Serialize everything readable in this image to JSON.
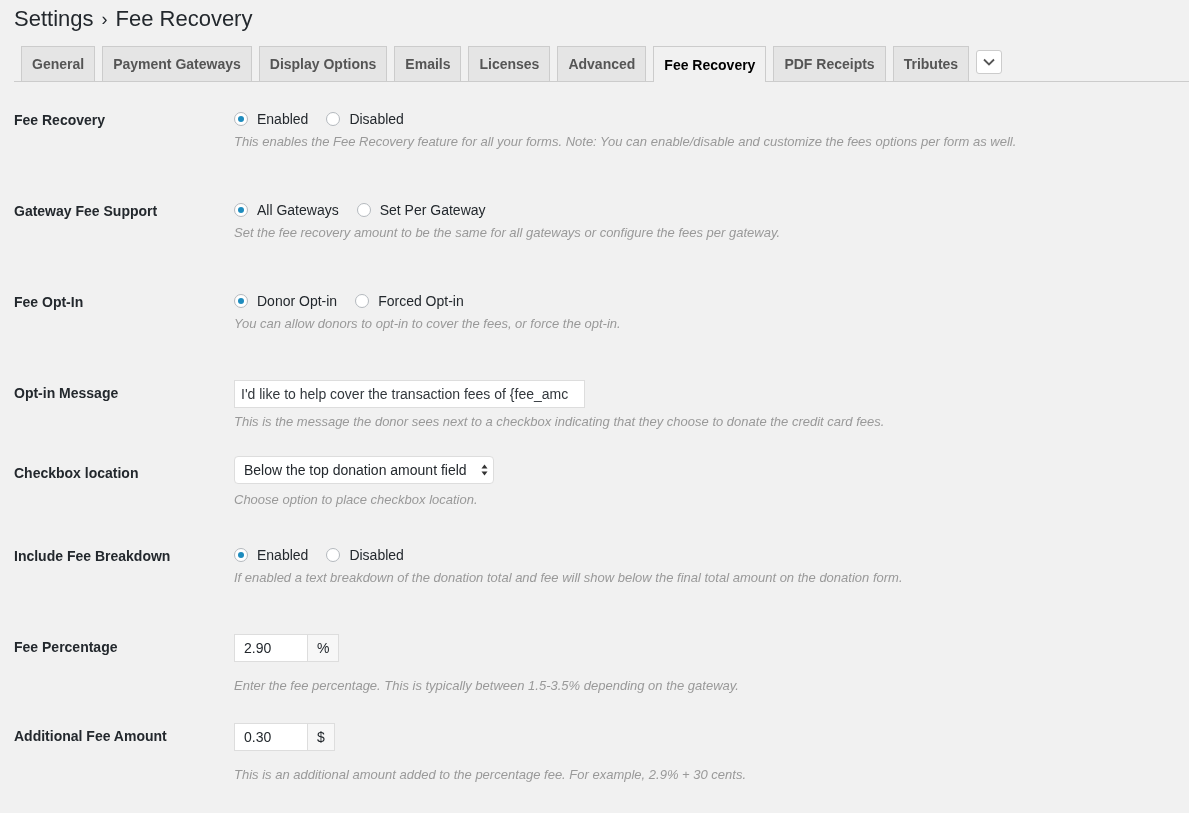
{
  "title": {
    "section": "Settings",
    "separator": "›",
    "page": "Fee Recovery"
  },
  "tabs": [
    {
      "label": "General",
      "selected": false
    },
    {
      "label": "Payment Gateways",
      "selected": false
    },
    {
      "label": "Display Options",
      "selected": false
    },
    {
      "label": "Emails",
      "selected": false
    },
    {
      "label": "Licenses",
      "selected": false
    },
    {
      "label": "Advanced",
      "selected": false
    },
    {
      "label": "Fee Recovery",
      "selected": true
    },
    {
      "label": "PDF Receipts",
      "selected": false
    },
    {
      "label": "Tributes",
      "selected": false
    }
  ],
  "settings": [
    {
      "kind": "radio",
      "label": "Fee Recovery",
      "options": [
        {
          "label": "Enabled",
          "selected": true
        },
        {
          "label": "Disabled",
          "selected": false
        }
      ],
      "description": "This enables the Fee Recovery feature for all your forms. Note: You can enable/disable and customize the fees options per form as well."
    },
    {
      "kind": "radio",
      "label": "Gateway Fee Support",
      "options": [
        {
          "label": "All Gateways",
          "selected": true
        },
        {
          "label": "Set Per Gateway",
          "selected": false
        }
      ],
      "description": "Set the fee recovery amount to be the same for all gateways or configure the fees per gateway."
    },
    {
      "kind": "radio",
      "label": "Fee Opt-In",
      "options": [
        {
          "label": "Donor Opt-in",
          "selected": true
        },
        {
          "label": "Forced Opt-in",
          "selected": false
        }
      ],
      "description": "You can allow donors to opt-in to cover the fees, or force the opt-in."
    },
    {
      "kind": "text",
      "label": "Opt-in Message",
      "value": "I'd like to help cover the transaction fees of {fee_amc",
      "description": "This is the message the donor sees next to a checkbox indicating that they choose to donate the credit card fees."
    },
    {
      "kind": "select",
      "label": "Checkbox location",
      "value": "Below the top donation amount field",
      "description": "Choose option to place checkbox location."
    },
    {
      "kind": "radio",
      "label": "Include Fee Breakdown",
      "options": [
        {
          "label": "Enabled",
          "selected": true
        },
        {
          "label": "Disabled",
          "selected": false
        }
      ],
      "description": "If enabled a text breakdown of the donation total and fee will show below the final total amount on the donation form."
    },
    {
      "kind": "number",
      "label": "Fee Percentage",
      "value": "2.90",
      "unit": "%",
      "description": "Enter the fee percentage. This is typically between 1.5-3.5% depending on the gateway."
    },
    {
      "kind": "number",
      "label": "Additional Fee Amount",
      "value": "0.30",
      "unit": "$",
      "description": "This is an additional amount added to the percentage fee. For example, 2.9% + 30 cents."
    }
  ]
}
